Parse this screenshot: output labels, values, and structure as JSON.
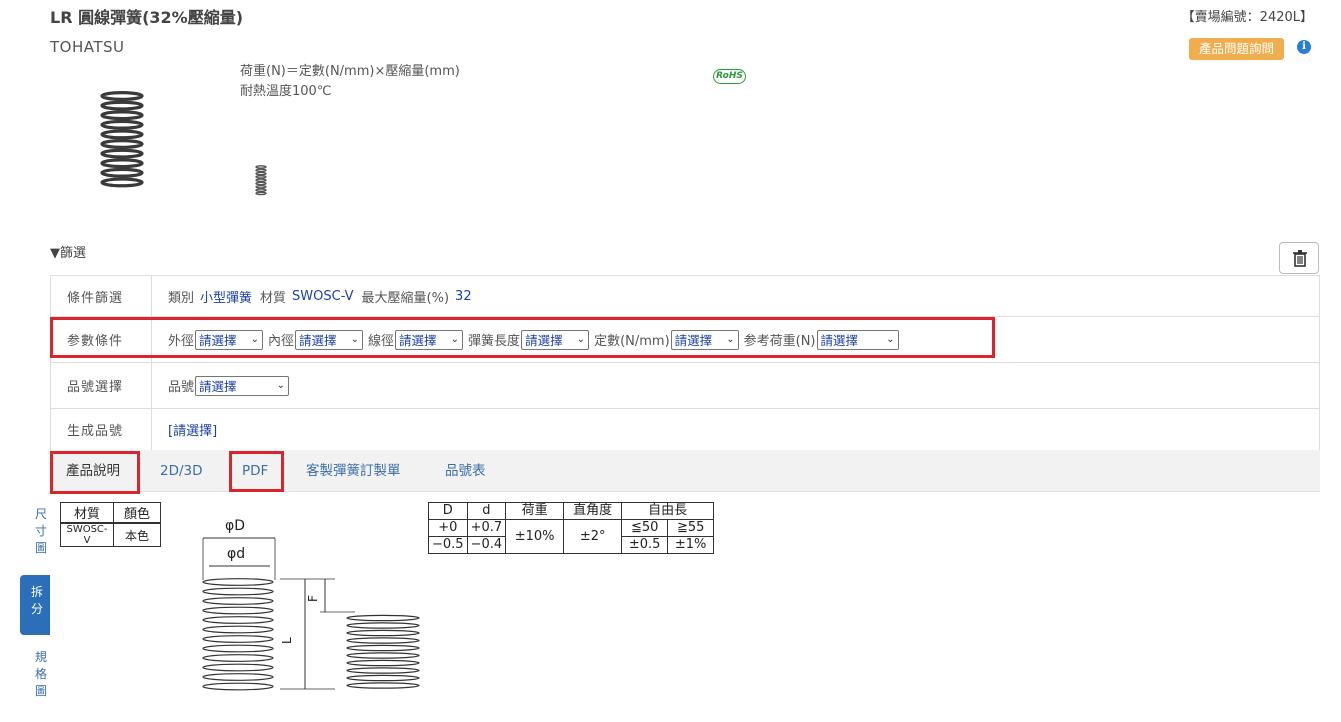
{
  "header": {
    "title": "LR 圓線彈簧(32%壓縮量)",
    "shop_no": "【賣場編號：2420L】",
    "brand": "TOHATSU",
    "inquiry_button": "產品問題詢問",
    "info_icon_glyph": "i"
  },
  "description": {
    "formula": "荷重(N)＝定數(N/mm)×壓縮量(mm)",
    "heat": "耐熱溫度100℃",
    "rohs": "RoHS"
  },
  "filter": {
    "section_label": "▼篩選",
    "rows": {
      "condition_label": "條件篩選",
      "param_label": "参數條件",
      "part_select_label": "品號選擇",
      "generated_label": "生成品號"
    },
    "condition": {
      "category_label": "類別",
      "category_value": "小型彈簧",
      "material_label": "材質",
      "material_value": "SWOSC-V",
      "max_comp_label": "最大壓縮量(%)",
      "max_comp_value": "32"
    },
    "params": [
      {
        "label": "外徑",
        "value": "請選擇"
      },
      {
        "label": "內徑",
        "value": "請選擇"
      },
      {
        "label": "線徑",
        "value": "請選擇"
      },
      {
        "label": "彈簧長度",
        "value": "請選擇"
      },
      {
        "label": "定數(N/mm)",
        "value": "請選擇"
      },
      {
        "label": "参考荷重(N)",
        "value": "請選擇"
      }
    ],
    "part": {
      "label": "品號",
      "value": "請選擇"
    },
    "generated_value": "[請選擇]"
  },
  "tabs": [
    {
      "label": "產品說明"
    },
    {
      "label": "2D/3D"
    },
    {
      "label": "PDF"
    },
    {
      "label": "客製彈簧訂製單"
    },
    {
      "label": "品號表"
    }
  ],
  "side_tabs": [
    {
      "label": "尺寸圖"
    },
    {
      "label": "拆分"
    },
    {
      "label": "規格圖"
    }
  ],
  "material_table": {
    "headers": [
      "材質",
      "顏色"
    ],
    "row": [
      "SWOSC-V",
      "本色"
    ]
  },
  "tolerance_table": {
    "headers": [
      "D",
      "d",
      "荷重",
      "直角度",
      "自由長"
    ],
    "free_length_sub": [
      "≦50",
      "≧55"
    ],
    "D": [
      "+0",
      "−0.5"
    ],
    "d": [
      "+0.7",
      "−0.4"
    ],
    "load": "±10%",
    "squareness": "±2°",
    "free_length_tol": [
      "±0.5",
      "±1%"
    ]
  },
  "drawing": {
    "label_outer": "φD",
    "label_wire": "φd",
    "label_L": "L",
    "label_F": "F"
  },
  "colors": {
    "accent_blue": "#1a3fa8",
    "tab_blue": "#3a6ea8",
    "highlight_red": "#d9262e",
    "inquiry_orange": "#f0ad4e"
  }
}
